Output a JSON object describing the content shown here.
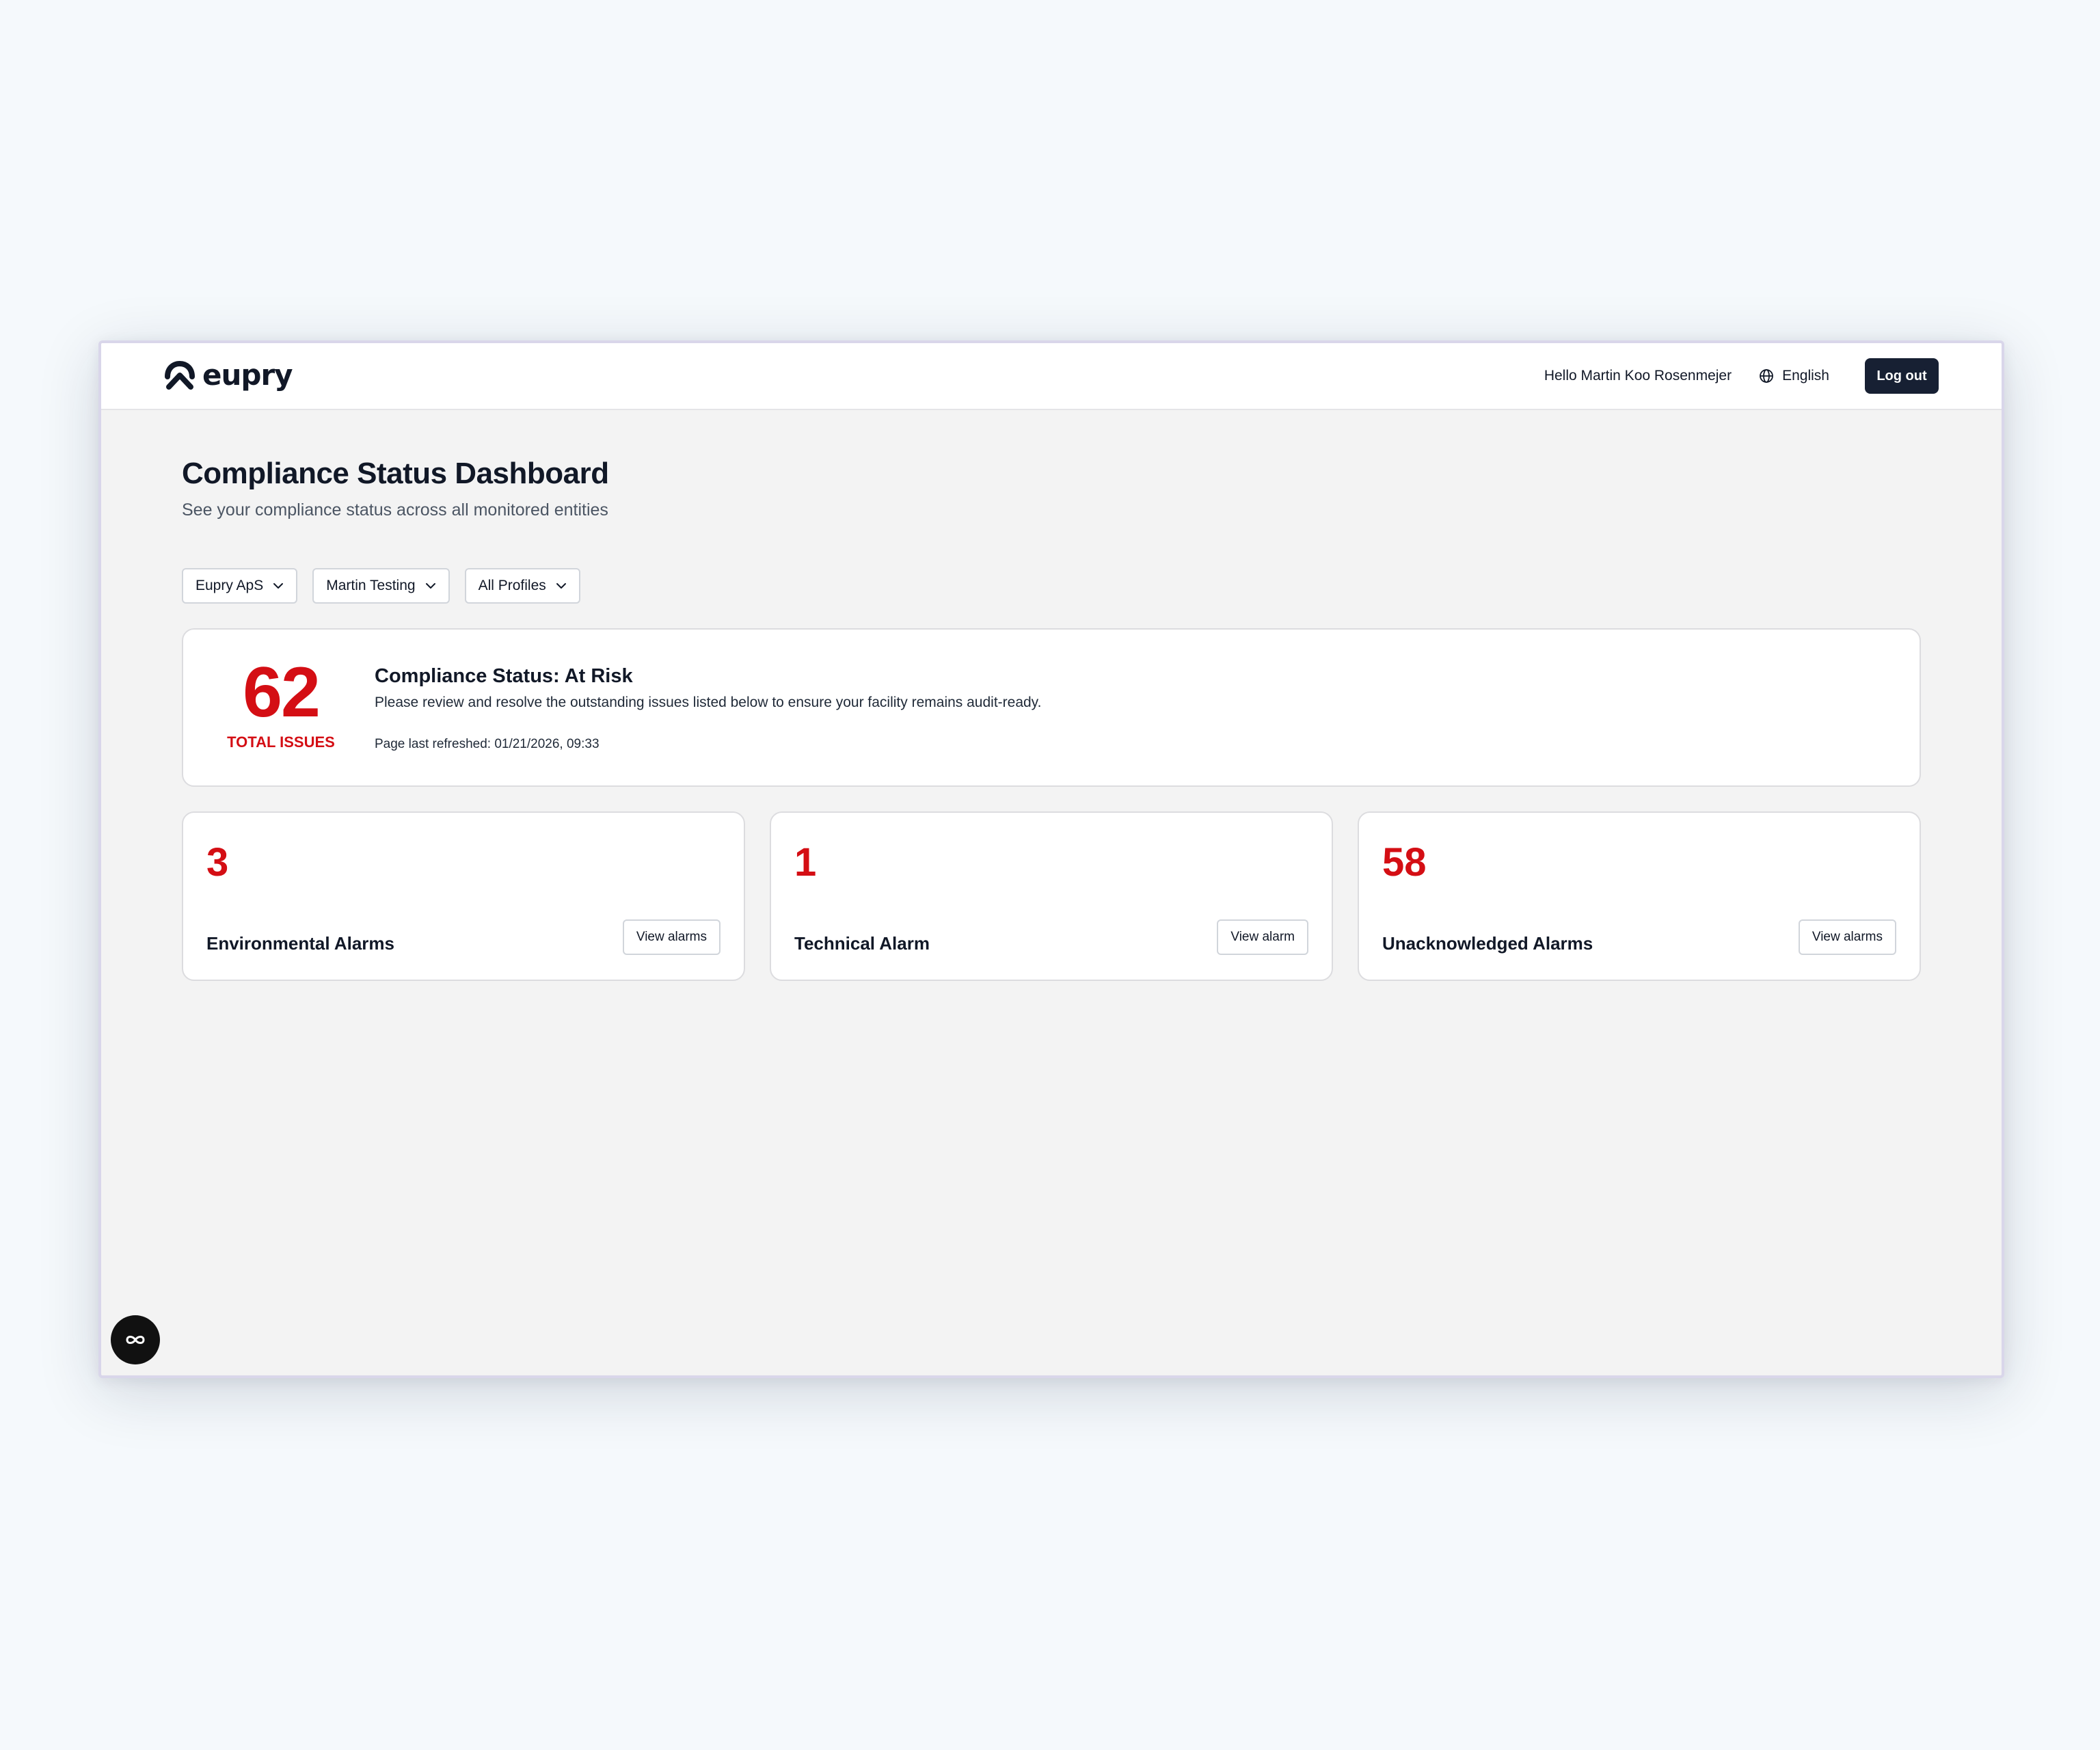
{
  "brand": {
    "name": "eupry"
  },
  "header": {
    "greeting": "Hello Martin Koo Rosenmejer",
    "language": "English",
    "logout_label": "Log out"
  },
  "page": {
    "title": "Compliance Status Dashboard",
    "subtitle": "See your compliance status across all monitored entities"
  },
  "filters": [
    {
      "label": "Eupry ApS"
    },
    {
      "label": "Martin Testing"
    },
    {
      "label": "All Profiles"
    }
  ],
  "summary": {
    "total": "62",
    "total_label": "TOTAL ISSUES",
    "status_title": "Compliance Status: At Risk",
    "description": "Please review and resolve the outstanding issues listed below to ensure your facility remains audit-ready.",
    "refreshed": "Page last refreshed: 01/21/2026, 09:33"
  },
  "alarms": [
    {
      "count": "3",
      "label": "Environmental Alarms",
      "button": "View alarms"
    },
    {
      "count": "1",
      "label": "Technical Alarm",
      "button": "View alarm"
    },
    {
      "count": "58",
      "label": "Unacknowledged Alarms",
      "button": "View alarms"
    }
  ],
  "colors": {
    "alert_red": "#d40e14",
    "navy": "#172033",
    "page_bg": "#f3f3f3"
  },
  "icons": {
    "logo": "eupry-logo-icon",
    "language": "globe-icon",
    "filter": "chevron-down-icon",
    "fab": "infinity-icon"
  }
}
